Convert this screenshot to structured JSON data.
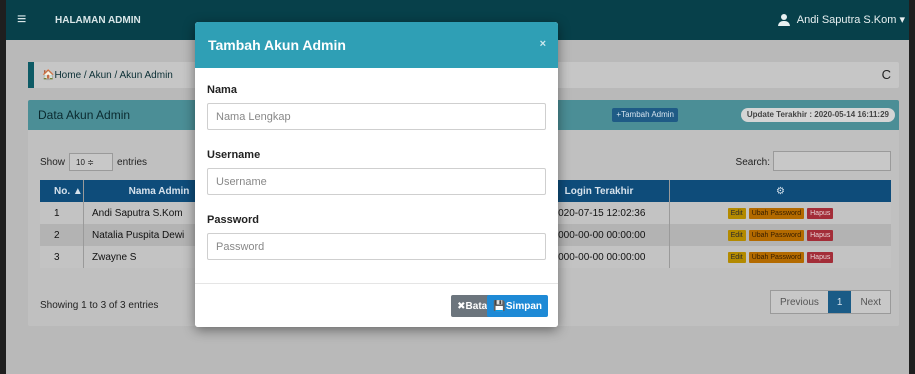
{
  "topbar": {
    "menu_icon": "hamburger-icon",
    "brand": "HALAMAN ADMIN",
    "user_name": "Andi Saputra S.Kom ▾",
    "user_icon": "user-icon"
  },
  "breadcrumb": {
    "text": "🏠Home / Akun / Akun Admin",
    "refresh_icon": "refresh-icon"
  },
  "panel": {
    "title": "Data Akun Admin",
    "add_button": "+Tambah Admin",
    "update_badge": "Update Terakhir : 2020-05-14 16:11:29",
    "show_label": "Show",
    "entries_value": "10 ≑",
    "entries_label": "entries",
    "search_label": "Search:",
    "columns": {
      "no": "No. ▲",
      "name": "Nama Admin",
      "login": "Login Terakhir",
      "action": "⚙"
    },
    "rows": [
      {
        "no": "1",
        "name": "Andi Saputra S.Kom",
        "login": "2020-07-15 12:02:36"
      },
      {
        "no": "2",
        "name": "Natalia Puspita Dewi",
        "login": "0000-00-00 00:00:00"
      },
      {
        "no": "3",
        "name": "Zwayne S",
        "login": "0000-00-00 00:00:00"
      }
    ],
    "actions": {
      "edit": "Edit",
      "password": "Ubah Password",
      "delete": "Hapus"
    },
    "showing": "Showing 1 to 3 of 3 entries",
    "pagination": {
      "previous": "Previous",
      "current": "1",
      "next": "Next"
    }
  },
  "modal": {
    "title": "Tambah Akun Admin",
    "close": "×",
    "fields": [
      {
        "label": "Nama",
        "placeholder": "Nama Lengkap"
      },
      {
        "label": "Username",
        "placeholder": "Username"
      },
      {
        "label": "Password",
        "placeholder": "Password"
      }
    ],
    "cancel_label": "✖Batal",
    "save_label": "💾Simpan"
  }
}
